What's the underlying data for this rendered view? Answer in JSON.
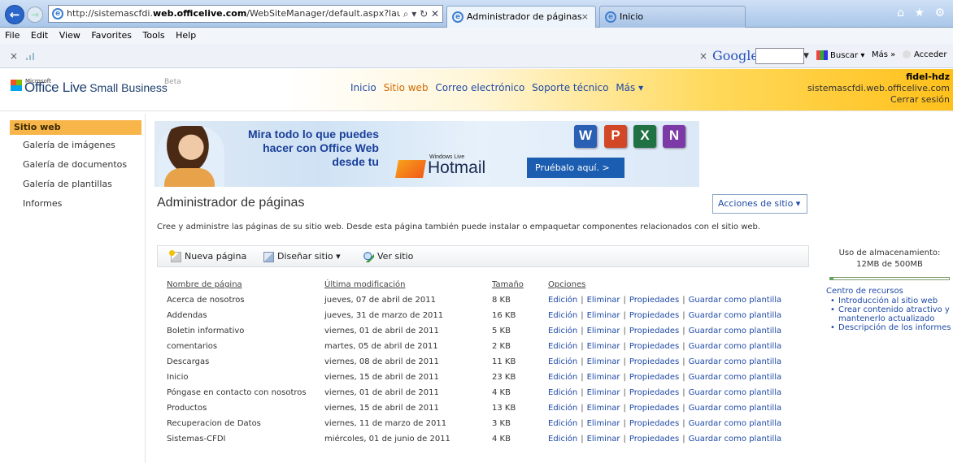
{
  "browser": {
    "address": {
      "prefix": "http://sistemascfdi.",
      "host": "web.officelive.com",
      "path": "/WebSiteManager/default.aspx?launchWe",
      "controls": "⌕ ▾ ↻ ✕"
    },
    "tabs": [
      {
        "label": "Administrador de páginas",
        "close": "×"
      },
      {
        "label": "Inicio"
      }
    ],
    "window_icons": "⌂ ★ ⚙",
    "menu": [
      "File",
      "Edit",
      "View",
      "Favorites",
      "Tools",
      "Help"
    ],
    "toolbar": {
      "close": "×",
      "close2": "×",
      "google": "Google",
      "buscar": "Buscar ▾",
      "mas": "Más »",
      "acceder": "Acceder"
    }
  },
  "header": {
    "logo_microsoft": "Microsoft",
    "logo_brand": "Office Live",
    "logo_small": "Small Business",
    "beta": "Beta",
    "nav": [
      "Inicio",
      "Sitio web",
      "Correo electrónico",
      "Soporte técnico",
      "Más ▾"
    ],
    "nav_current": 1,
    "user_name": "fidel-hdz",
    "user_site": "sistemascfdi.web.officelive.com",
    "signout": "Cerrar sesión"
  },
  "sidebar": {
    "active": "Sitio web",
    "items": [
      "Galería de imágenes",
      "Galería de documentos",
      "Galería de plantillas",
      "Informes"
    ]
  },
  "banner": {
    "line1": "Mira todo lo que puedes",
    "line2": "hacer con Office Web",
    "line3": "desde tu",
    "windows_live": "Windows Live",
    "hotmail": "Hotmail",
    "button": "Pruébalo aquí.  >",
    "icons": [
      "W",
      "P",
      "X",
      "N"
    ]
  },
  "page": {
    "title": "Administrador de páginas",
    "site_actions": "Acciones de sitio  ▾",
    "description": "Cree y administre las páginas de su sitio web. Desde esta página también puede instalar o empaquetar componentes relacionados con el sitio web.",
    "actions": {
      "new": "Nueva página",
      "design": "Diseñar sitio  ▾",
      "view": "Ver sitio"
    }
  },
  "table": {
    "headers": [
      "Nombre de página",
      "Última modificación",
      "Tamaño",
      "Opciones"
    ],
    "ops": [
      "Edición",
      "Eliminar",
      "Propiedades",
      "Guardar como plantilla"
    ],
    "rows": [
      [
        "Acerca de nosotros",
        "jueves, 07 de abril de 2011",
        "8 KB"
      ],
      [
        "Addendas",
        "jueves, 31 de marzo de 2011",
        "16 KB"
      ],
      [
        "Boletin informativo",
        "viernes, 01 de abril de 2011",
        "5 KB"
      ],
      [
        "comentarios",
        "martes, 05 de abril de 2011",
        "2 KB"
      ],
      [
        "Descargas",
        "viernes, 08 de abril de 2011",
        "11 KB"
      ],
      [
        "Inicio",
        "viernes, 15 de abril de 2011",
        "23 KB"
      ],
      [
        "Póngase en contacto con nosotros",
        "viernes, 01 de abril de 2011",
        "4 KB"
      ],
      [
        "Productos",
        "viernes, 15 de abril de 2011",
        "13 KB"
      ],
      [
        "Recuperacion de Datos",
        "viernes, 11 de marzo de 2011",
        "3 KB"
      ],
      [
        "Sistemas-CFDI",
        "miércoles, 01 de junio de 2011",
        "4 KB"
      ]
    ]
  },
  "storage": {
    "label": "Uso de almacenamiento:",
    "value": "12MB de 500MB",
    "fraction": 0.024
  },
  "resources": {
    "title": "Centro de recursos",
    "items": [
      "Introducción al sitio web",
      "Crear contenido atractivo y mantenerlo actualizado",
      "Descripción de los informes"
    ]
  }
}
